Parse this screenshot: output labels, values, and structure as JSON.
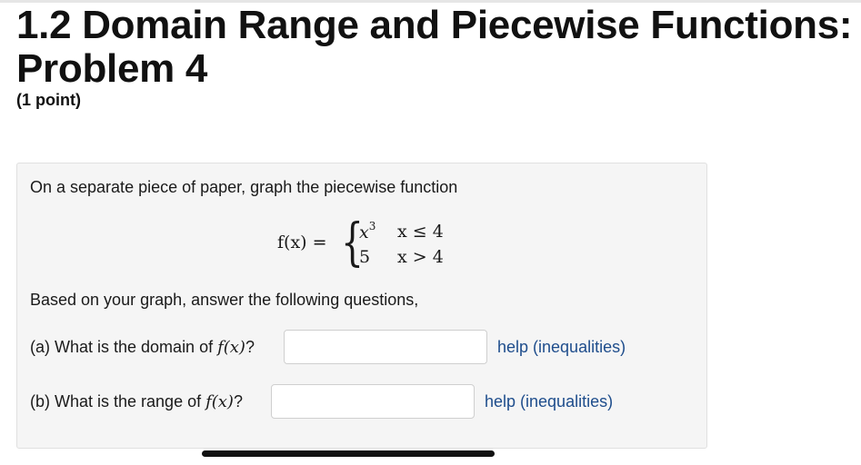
{
  "header": {
    "title_line1": "1.2 Domain Range and  Piecewise Functions:",
    "title_line2": "Problem 4",
    "points": "(1 point)"
  },
  "problem": {
    "intro": "On a separate piece of paper, graph the piecewise function",
    "formula": {
      "lhs": "f(x) =",
      "case1_expr": "x",
      "case1_exp": "3",
      "case1_cond": "x ≤ 4",
      "case2_expr": "5",
      "case2_cond": "x > 4"
    },
    "instruction": "Based on your graph, answer the following questions,",
    "part_a": {
      "prefix": "(a) What is the domain of ",
      "math": "f(x)",
      "suffix": "?",
      "value": "",
      "help": "help (inequalities)"
    },
    "part_b": {
      "prefix": "(b) What is the range of ",
      "math": "f(x)",
      "suffix": "?",
      "value": "",
      "help": "help (inequalities)"
    }
  }
}
